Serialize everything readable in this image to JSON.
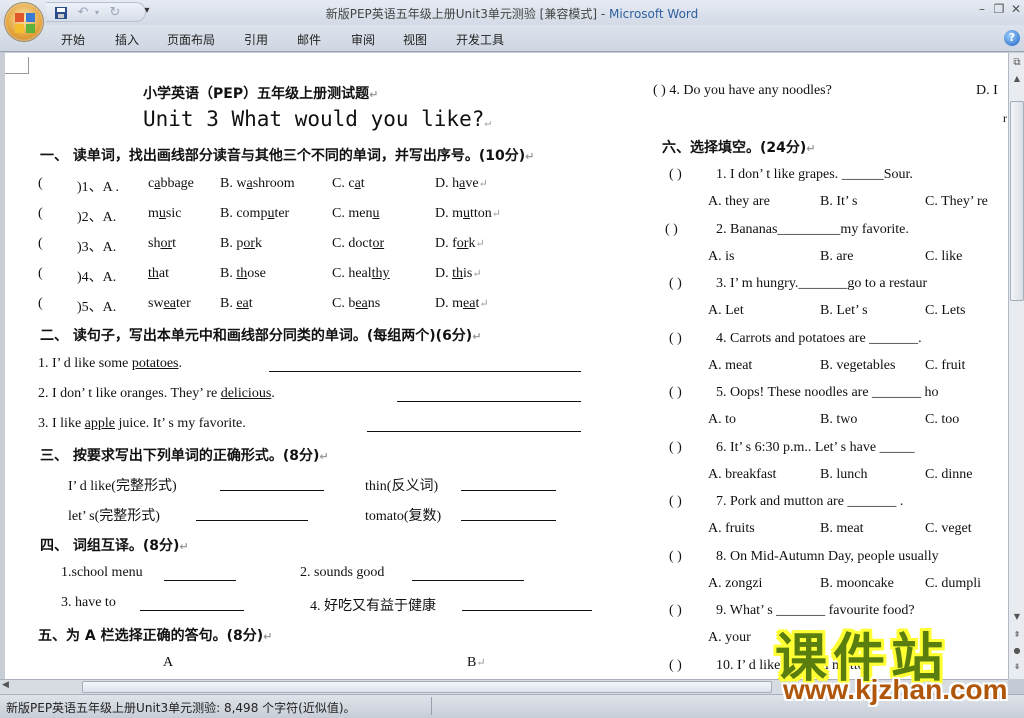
{
  "window": {
    "title_doc": "新版PEP英语五年级上册Unit3单元测验 [兼容模式]",
    "title_sep": " - ",
    "title_app": "Microsoft Word",
    "minimize": "–",
    "restore": "❐",
    "close": "✕"
  },
  "quick_access": {
    "save_icon": "save-icon",
    "undo_icon": "undo-icon",
    "redo_icon": "redo-icon",
    "customize": "▾"
  },
  "ribbon": {
    "tabs": [
      "开始",
      "插入",
      "页面布局",
      "引用",
      "邮件",
      "审阅",
      "视图",
      "开发工具"
    ],
    "help": "?"
  },
  "page1": {
    "heading1": "小学英语（PEP）五年级上册测试题",
    "heading2": "Unit 3  What would you like?",
    "s1": {
      "title": "一、  读单词，找出画线部分读音与其他三个不同的单词，并写出序号。(10分)",
      "items": [
        {
          "paren": "(",
          "num": ")1、A .",
          "a_pre": "c",
          "a_u": "a",
          "a_post": "bbage",
          "b_lbl": "B.",
          "b_pre": "w",
          "b_u": "a",
          "b_post": "shroom",
          "c_lbl": "C.",
          "c_pre": "c",
          "c_u": "a",
          "c_post": "t",
          "d_lbl": "D.",
          "d_pre": "h",
          "d_u": "a",
          "d_post": "ve"
        },
        {
          "paren": "(",
          "num": ")2、A.",
          "a_pre": "m",
          "a_u": "u",
          "a_post": "sic",
          "b_lbl": "B.",
          "b_pre": "comp",
          "b_u": "u",
          "b_post": "ter",
          "c_lbl": "C.",
          "c_pre": "men",
          "c_u": "u",
          "c_post": "",
          "d_lbl": "D.",
          "d_pre": "m",
          "d_u": "u",
          "d_post": "tton"
        },
        {
          "paren": "(",
          "num": ")3、A.",
          "a_pre": "sh",
          "a_u": "or",
          "a_post": "t",
          "b_lbl": "B.",
          "b_pre": "p",
          "b_u": "or",
          "b_post": "k",
          "c_lbl": "C.",
          "c_pre": "doct",
          "c_u": "or",
          "c_post": "",
          "d_lbl": "D.",
          "d_pre": "f",
          "d_u": "or",
          "d_post": "k"
        },
        {
          "paren": "(",
          "num": ")4、A.",
          "a_pre": "",
          "a_u": "th",
          "a_post": "at",
          "b_lbl": "B.",
          "b_pre": "",
          "b_u": "th",
          "b_post": "ose",
          "c_lbl": "C.",
          "c_pre": "heal",
          "c_u": "thy",
          "c_post": "",
          "d_lbl": "D.",
          "d_pre": "",
          "d_u": "th",
          "d_post": "is"
        },
        {
          "paren": "(",
          "num": ")5、A.",
          "a_pre": "sw",
          "a_u": "ea",
          "a_post": "ter",
          "b_lbl": "B.",
          "b_pre": "",
          "b_u": "ea",
          "b_post": "t",
          "c_lbl": "C.",
          "c_pre": "b",
          "c_u": "ea",
          "c_post": "ns",
          "d_lbl": "D.",
          "d_pre": "m",
          "d_u": "ea",
          "d_post": "t"
        }
      ]
    },
    "s2": {
      "title": "二、  读句子，写出本单元中和画线部分同类的单词。(每组两个)(6分)",
      "items": [
        {
          "pre": "1. I’ d like some ",
          "u": "potatoes",
          "post": "."
        },
        {
          "pre": "2. I don’ t like oranges. They’ re ",
          "u": "delicious",
          "post": "."
        },
        {
          "pre": "3. I like ",
          "u": "apple",
          "post": " juice. It’ s my favorite."
        }
      ]
    },
    "s3": {
      "title": "三、  按要求写出下列单词的正确形式。(8分)",
      "items": [
        "I’ d like(完整形式)",
        "thin(反义词)",
        "let’ s(完整形式)",
        "tomato(复数)"
      ]
    },
    "s4": {
      "title": "四、  词组互译。(8分)",
      "items": [
        "1.school menu",
        "2.  sounds good",
        "3.  have to",
        "4.  好吃又有益于健康"
      ]
    },
    "s5": {
      "title": "五、为 A 栏选择正确的答句。(8分)",
      "col_a": "A",
      "col_b": "B"
    }
  },
  "page2": {
    "top_item": {
      "paren": "(   )",
      "text": "4.  Do you have any noodles?",
      "opt": "D.  I",
      "cut": "r"
    },
    "s6": {
      "title": "六、选择填空。(24分)",
      "questions": [
        {
          "paren": "(    )",
          "text": "1.  I don’ t like grapes. ______Sour.",
          "opts": [
            "A.  they are",
            "B.  It’ s",
            "C.  They’ re"
          ]
        },
        {
          "paren": "(    )",
          "text": "2.  Bananas_________my favorite.",
          "opts": [
            "A.  is",
            "B.  are",
            "C.  like"
          ]
        },
        {
          "paren": "(    )",
          "text": "3.  I’ m hungry._______go to a restaur",
          "opts": [
            "A.  Let",
            "B.  Let’ s",
            "C.  Lets"
          ]
        },
        {
          "paren": "(    )",
          "text": "4.  Carrots and potatoes are _______.",
          "opts": [
            "A.  meat",
            "B.  vegetables",
            "C.  fruit"
          ]
        },
        {
          "paren": "(    )",
          "text": "5.  Oops! These noodles are _______ ho",
          "opts": [
            "A.  to",
            "B.  two",
            "C.  too"
          ]
        },
        {
          "paren": "(    )",
          "text": "6.  It’ s 6:30 p.m.. Let’ s have _____",
          "opts": [
            "A.  breakfast",
            "B.  lunch",
            "C.  dinne"
          ]
        },
        {
          "paren": "(    )",
          "text": "7.  Pork and mutton are _______ .",
          "opts": [
            "A.  fruits",
            "B.  meat",
            "C.  veget"
          ]
        },
        {
          "paren": "(    )",
          "text": "8.  On Mid-Autumn Day, people usually",
          "opts": [
            "A.  zongzi",
            "B.  mooncake",
            "C.  dumpli"
          ]
        },
        {
          "paren": "(    )",
          "text": "9.  What’ s _______  favourite food?",
          "opts": [
            "A.  your",
            "",
            ""
          ]
        },
        {
          "paren": "(    )",
          "text": "10.  I’ d like rice and mutton",
          "opts": []
        }
      ]
    }
  },
  "statusbar": {
    "text": "新版PEP英语五年级上册Unit3单元测验: 8,498 个字符(近似值)。"
  },
  "watermark": {
    "main": "课件站",
    "url": "www.kjzhan.com"
  }
}
